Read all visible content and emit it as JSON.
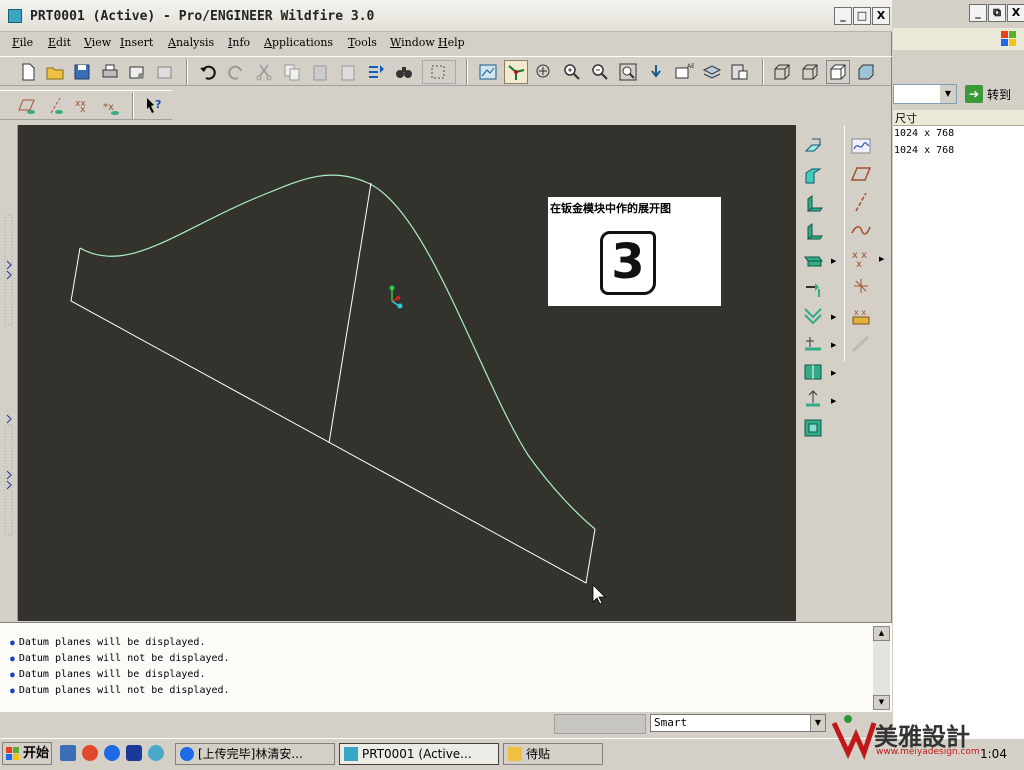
{
  "window": {
    "title": "PRT0001 (Active) - Pro/ENGINEER Wildfire 3.0",
    "controls": [
      "_",
      "□",
      "X"
    ]
  },
  "menu": [
    "File",
    "Edit",
    "View",
    "Insert",
    "Analysis",
    "Info",
    "Applications",
    "Tools",
    "Window",
    "Help"
  ],
  "menu_underlines": [
    "F",
    "E",
    "V",
    "I",
    "A",
    "I",
    "A",
    "T",
    "W",
    "H"
  ],
  "canvas": {
    "background": "#33322d",
    "curve_color": "#aaf0c8",
    "line_color": "#ffffff"
  },
  "note": {
    "title": "在钣金模块中作的展开图",
    "digit": "3"
  },
  "messages": [
    "Datum planes will be displayed.",
    "Datum planes will not be displayed.",
    "Datum planes will be displayed.",
    "Datum planes will not be displayed."
  ],
  "status": {
    "filter": "Smart"
  },
  "right_pane": {
    "goto_label": "转到",
    "column_header": "尺寸",
    "rows": [
      "1024 x 768",
      "1024 x 768"
    ]
  },
  "taskbar": {
    "start": "开始",
    "tasks": [
      "[上传完毕]林清安...",
      "PRT0001 (Active...",
      "待贴"
    ],
    "clock": "1:04",
    "watermark_text": "美雅設計",
    "watermark_url": "www.meiyadesign.com"
  }
}
